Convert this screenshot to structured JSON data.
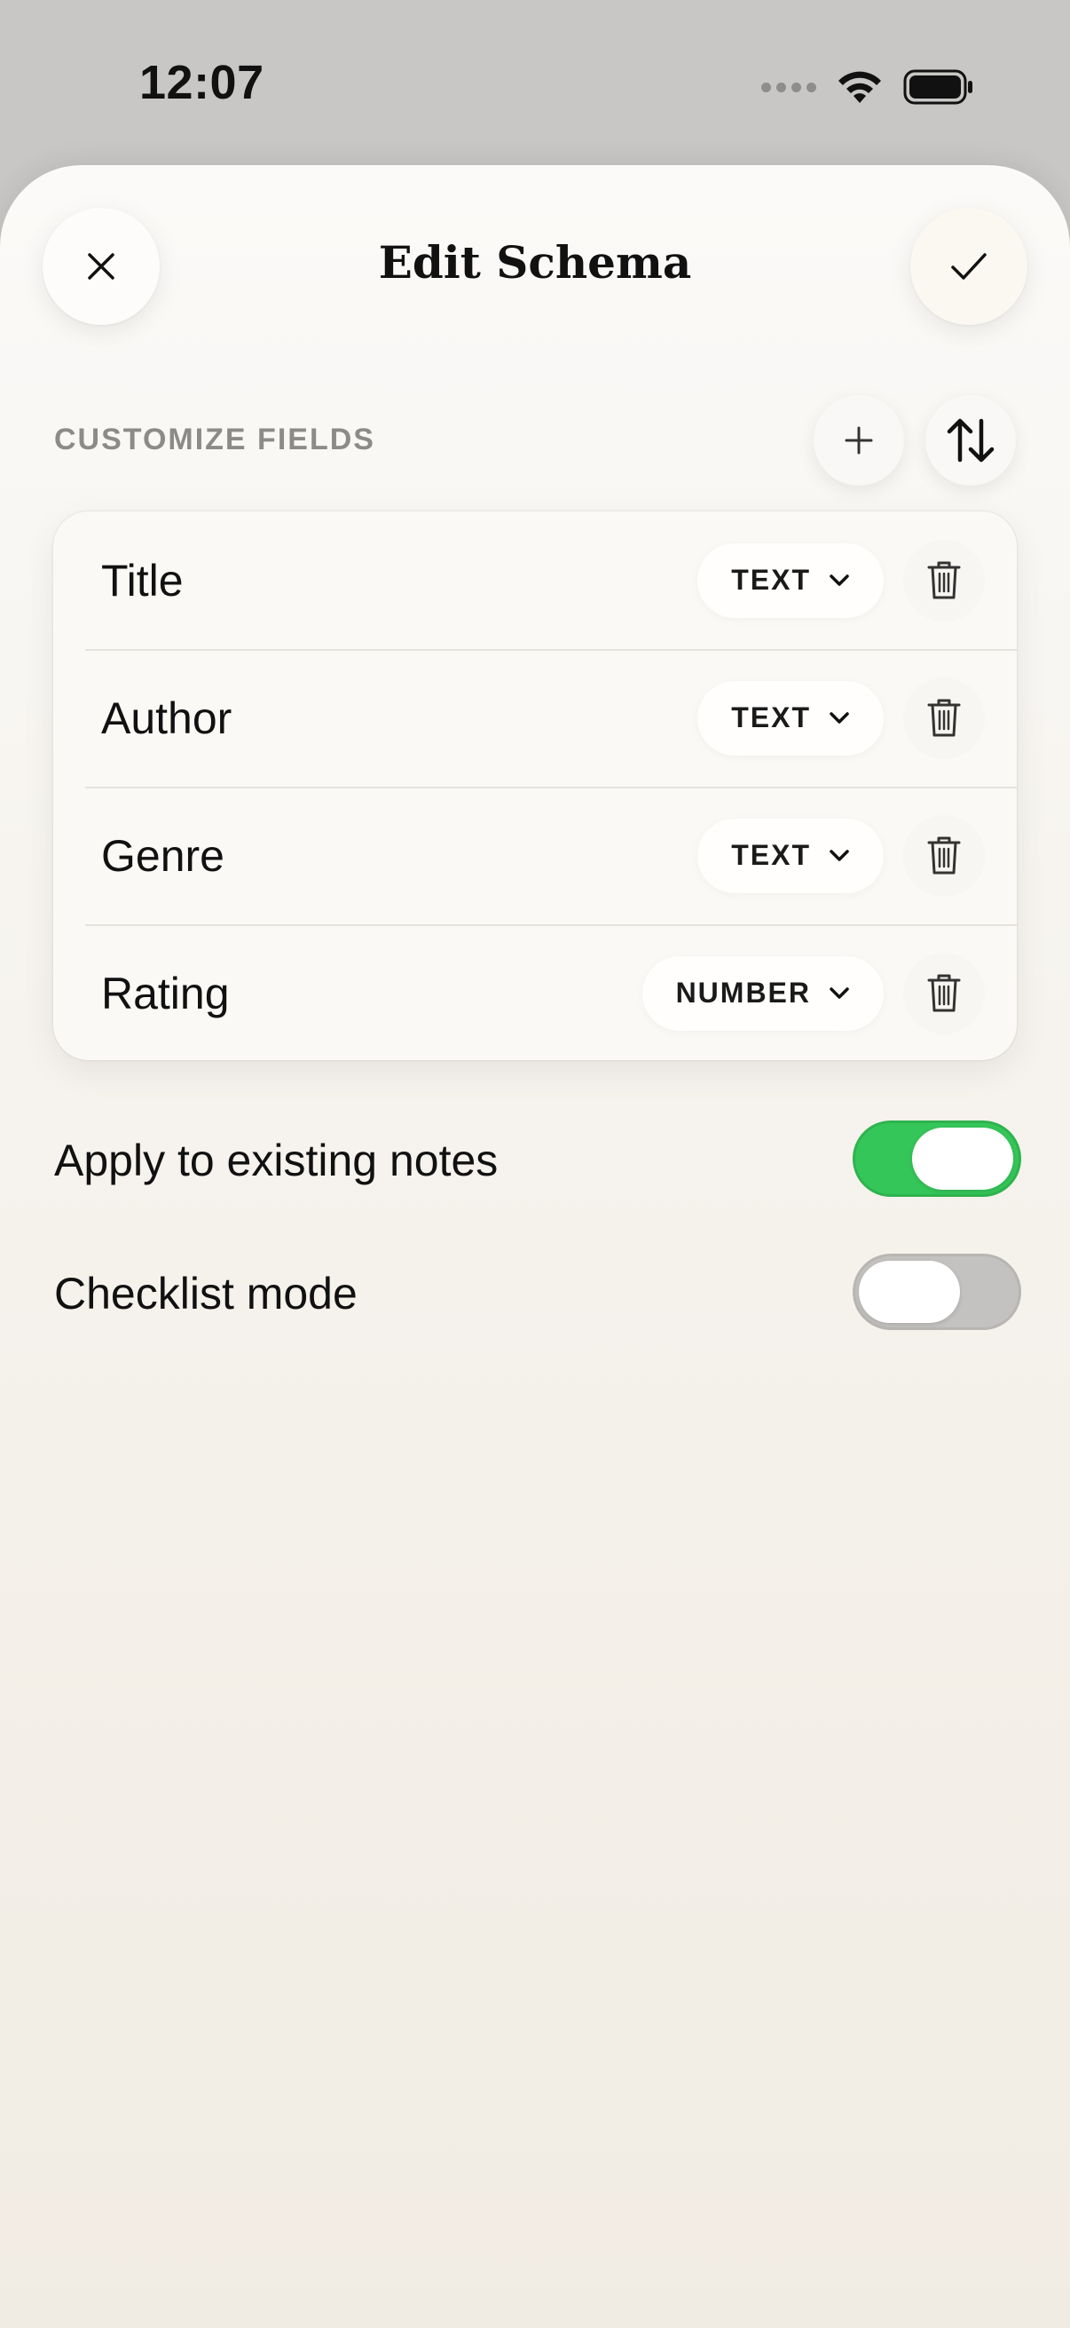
{
  "status_bar": {
    "time": "12:07"
  },
  "header": {
    "title": "Edit Schema",
    "close_icon": "close-icon",
    "done_icon": "checkmark-icon"
  },
  "section": {
    "label": "CUSTOMIZE FIELDS",
    "add_icon": "plus-icon",
    "reorder_icon": "sort-arrows-icon"
  },
  "fields": [
    {
      "name": "Title",
      "type": "TEXT"
    },
    {
      "name": "Author",
      "type": "TEXT"
    },
    {
      "name": "Genre",
      "type": "TEXT"
    },
    {
      "name": "Rating",
      "type": "NUMBER"
    }
  ],
  "options": {
    "apply_existing": {
      "label": "Apply to existing notes",
      "enabled": true
    },
    "checklist_mode": {
      "label": "Checklist mode",
      "enabled": false
    }
  },
  "colors": {
    "toggle_on": "#35c659",
    "toggle_off": "#c4c2c0",
    "section_label": "#8d8b88"
  }
}
